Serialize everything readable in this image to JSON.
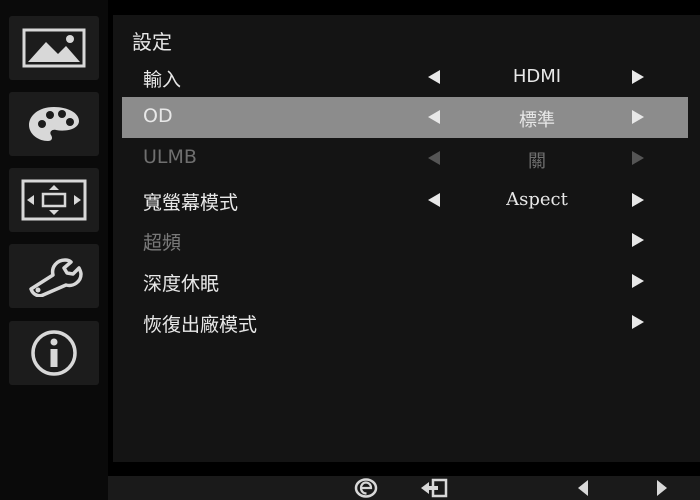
{
  "menu": {
    "title": "設定",
    "items": [
      {
        "label": "輸入",
        "value": "HDMI"
      },
      {
        "label": "OD",
        "value": "標準"
      },
      {
        "label": "ULMB",
        "value": "關"
      },
      {
        "label": "寬螢幕模式",
        "value": "Aspect"
      },
      {
        "label": "超頻",
        "value": ""
      },
      {
        "label": "深度休眠",
        "value": ""
      },
      {
        "label": "恢復出廠模式",
        "value": ""
      }
    ]
  },
  "sidebar": {
    "icons": [
      "picture-icon",
      "color-palette-icon",
      "aspect-ratio-icon",
      "wrench-icon",
      "info-icon"
    ]
  },
  "bottom": {
    "icons": [
      "e-mode-icon",
      "exit-icon",
      "left-arrow-icon",
      "right-arrow-icon"
    ]
  },
  "colors": {
    "selected_row": "#8c8c8c",
    "disabled_text": "#6f6f6f",
    "normal_text": "#e8e8e8",
    "panel": "#141414"
  }
}
